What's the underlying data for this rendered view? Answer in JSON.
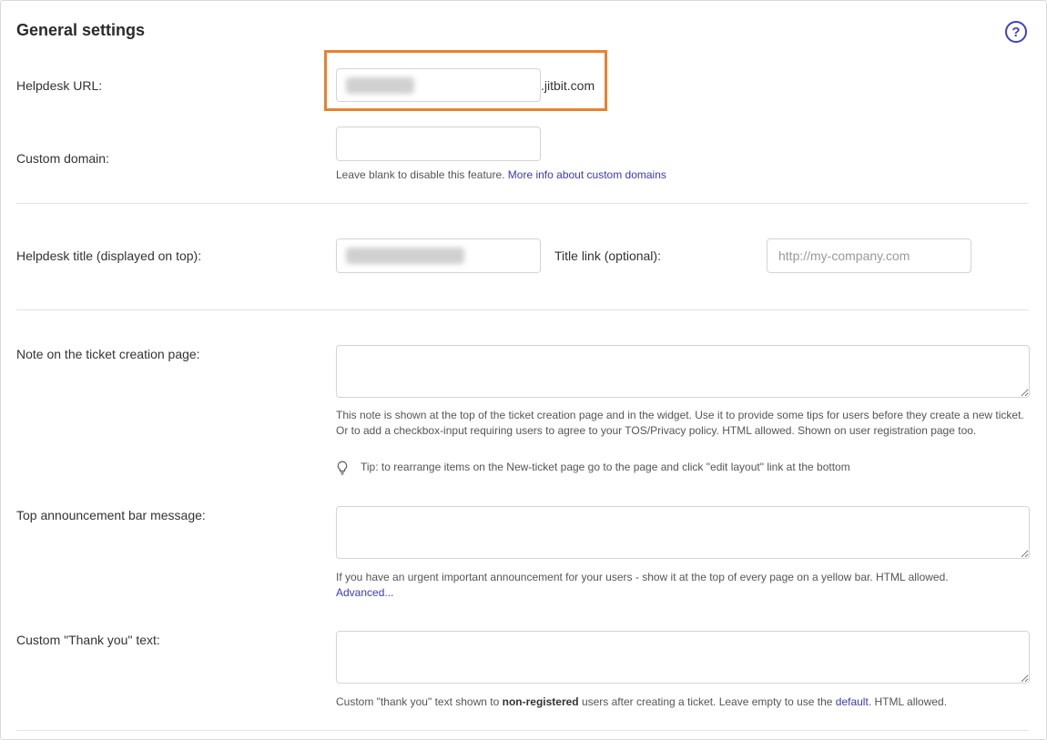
{
  "header": {
    "title": "General settings",
    "help_icon": "question-circle-icon"
  },
  "helpdesk_url": {
    "label": "Helpdesk URL:",
    "suffix": ".jitbit.com"
  },
  "custom_domain": {
    "label": "Custom domain:",
    "hint": "Leave blank to disable this feature. ",
    "link": "More info about custom domains"
  },
  "helpdesk_title": {
    "label": "Helpdesk title (displayed on top):"
  },
  "title_link": {
    "label": "Title link (optional):",
    "placeholder": "http://my-company.com"
  },
  "note": {
    "label": "Note on the ticket creation page:",
    "hint": "This note is shown at the top of the ticket creation page and in the widget. Use it to provide some tips for users before they create a new ticket. Or to add a checkbox-input requiring users to agree to your TOS/Privacy policy. HTML allowed. Shown on user registration page too.",
    "tip": "Tip: to rearrange items on the New-ticket page go to the page and click \"edit layout\" link at the bottom",
    "tip_icon": "lightbulb-icon"
  },
  "announcement": {
    "label": "Top announcement bar message:",
    "hint": "If you have an urgent important announcement for your users - show it at the top of every page on a yellow bar. HTML allowed.",
    "link": "Advanced..."
  },
  "thank_you": {
    "label": "Custom \"Thank you\" text:",
    "hint_before": "Custom \"thank you\" text shown to ",
    "hint_bold": "non-registered",
    "hint_middle": " users after creating a ticket. Leave empty to use the ",
    "hint_link": "default",
    "hint_after": ". HTML allowed."
  },
  "colors": {
    "accent": "#3f3fc4",
    "highlight": "#e8822e"
  }
}
